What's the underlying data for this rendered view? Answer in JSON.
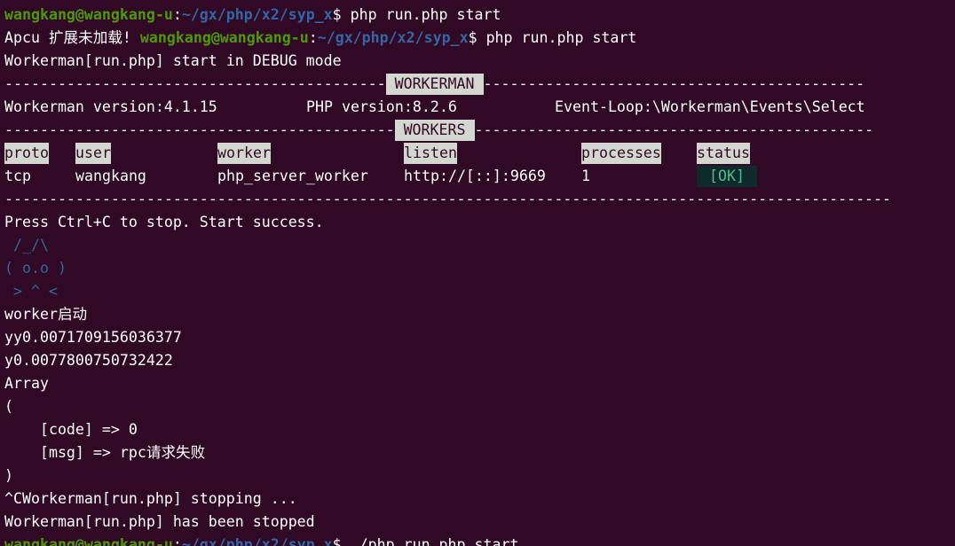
{
  "prompt": {
    "user_host": "wangkang@wangkang-u",
    "colon": ":",
    "path": "~/gx/php/x2/syp_x",
    "dollar": "$ "
  },
  "lines": {
    "cmd1": "php run.php start",
    "apcu_warn": "Apcu 扩展未加载! ",
    "cmd2": "php run.php start",
    "debug": "Workerman[run.php] start in DEBUG mode",
    "dash_left_1": "-------------------------------------------",
    "dash_right_1": "-------------------------------------------",
    "workerman_label": " WORKERMAN ",
    "info_wm_version": "Workerman version:4.1.15",
    "info_php_version": "PHP version:8.2.6",
    "info_event_loop": "Event-Loop:\\Workerman\\Events\\Select",
    "dash_left_2": "--------------------------------------------",
    "dash_right_2": "---------------------------------------------",
    "workers_label": " WORKERS ",
    "dash_full": "----------------------------------------------------------------------------------------------------",
    "press_stop": "Press Ctrl+C to stop. Start success.",
    "art1": " /_/\\",
    "art2": "( o.o )",
    "art3": " > ^ <",
    "worker_start": "worker启动",
    "yy": "yy0.0071709156036377",
    "y": "y0.0077800750732422",
    "array": "Array",
    "open_paren": "(",
    "code_line": "    [code] => 0",
    "msg_line": "    [msg] => rpc请求失败",
    "close_paren": ")",
    "stopping": "^CWorkerman[run.php] stopping ...",
    "stopped": "Workerman[run.php] has been stopped",
    "cmd3": "./php run.php start"
  },
  "table": {
    "headers": {
      "proto": "proto",
      "user": "user",
      "worker": "worker",
      "listen": "listen",
      "processes": "processes",
      "status": "status"
    },
    "row": {
      "proto": "tcp",
      "user": "wangkang",
      "worker": "php_server_worker",
      "listen": "http://[::]:9669",
      "processes": "1",
      "status": " [OK] "
    }
  },
  "colors": {
    "background": "#300a24",
    "prompt_user": "#4e9a06",
    "prompt_path": "#3465a4",
    "label_bg": "#d3d7cf",
    "ok_text": "#4ebf8a"
  }
}
